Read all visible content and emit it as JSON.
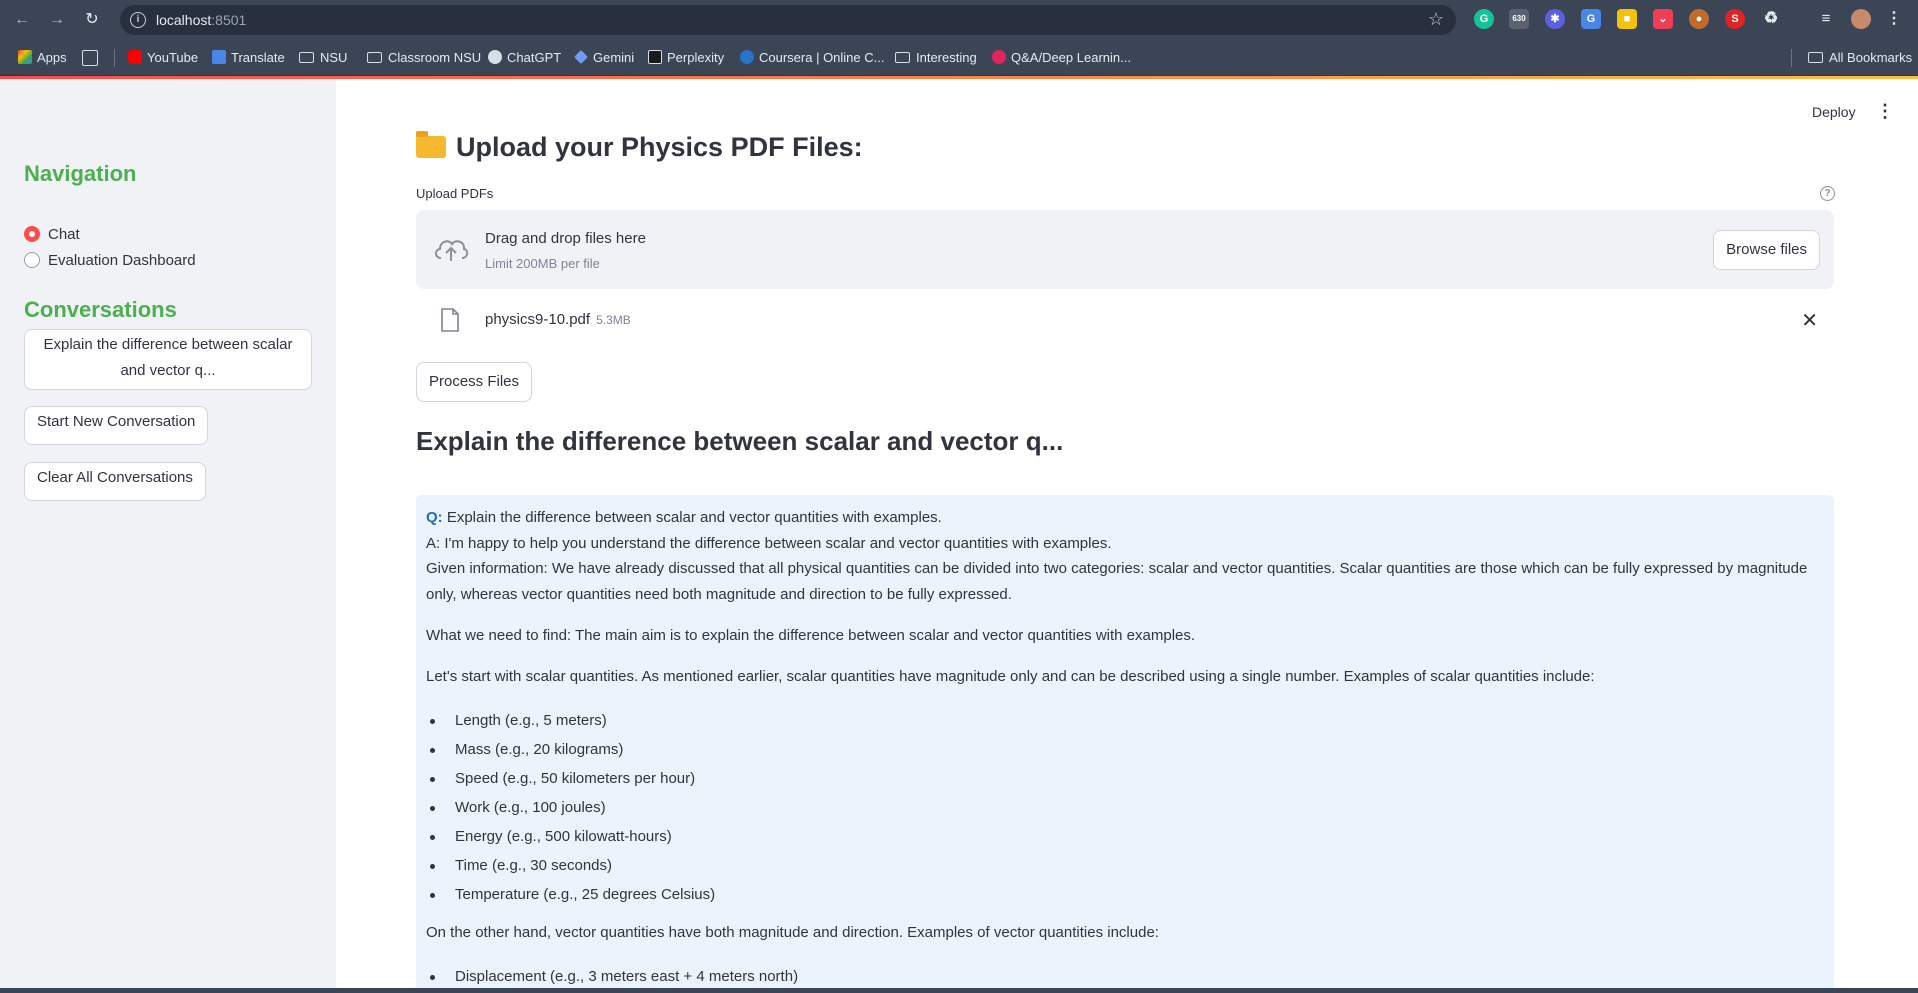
{
  "browser": {
    "url_host": "localhost",
    "url_port": ":8501",
    "ext_badge_count": "630",
    "bookmarks": [
      {
        "label": "Apps"
      },
      {
        "label": "YouTube"
      },
      {
        "label": "Translate"
      },
      {
        "label": "NSU"
      },
      {
        "label": "Classroom NSU"
      },
      {
        "label": "ChatGPT"
      },
      {
        "label": "Gemini"
      },
      {
        "label": "Perplexity"
      },
      {
        "label": "Coursera | Online C..."
      },
      {
        "label": "Interesting"
      },
      {
        "label": "Q&A/Deep Learnin..."
      }
    ],
    "all_bookmarks": "All Bookmarks"
  },
  "sidebar": {
    "nav_title": "Navigation",
    "radio_options": [
      {
        "label": "Chat",
        "selected": true
      },
      {
        "label": "Evaluation Dashboard",
        "selected": false
      }
    ],
    "conv_title": "Conversations",
    "conversation_items": [
      {
        "label": "Explain the difference between scalar and vector q..."
      }
    ],
    "new_conv_label": "Start New Conversation",
    "clear_label": "Clear All Conversations"
  },
  "header": {
    "deploy_label": "Deploy"
  },
  "upload": {
    "heading": "Upload your Physics PDF Files:",
    "label": "Upload PDFs",
    "drop_title": "Drag and drop files here",
    "drop_limit": "Limit 200MB per file",
    "browse_label": "Browse files",
    "file_name": "physics9-10.pdf",
    "file_size": "5.3MB",
    "process_label": "Process Files"
  },
  "conversation": {
    "heading": "Explain the difference between scalar and vector q...",
    "q_prefix": "Q:",
    "question": " Explain the difference between scalar and vector quantities with examples.",
    "answer_intro": "A: I'm happy to help you understand the difference between scalar and vector quantities with examples.",
    "given_info": "Given information: We have already discussed that all physical quantities can be divided into two categories: scalar and vector quantities. Scalar quantities are those which can be fully expressed by magnitude only, whereas vector quantities need both magnitude and direction to be fully expressed.",
    "need_to_find": "What we need to find: The main aim is to explain the difference between scalar and vector quantities with examples.",
    "scalar_intro": "Let's start with scalar quantities. As mentioned earlier, scalar quantities have magnitude only and can be described using a single number. Examples of scalar quantities include:",
    "scalar_examples": [
      "Length (e.g., 5 meters)",
      "Mass (e.g., 20 kilograms)",
      "Speed (e.g., 50 kilometers per hour)",
      "Work (e.g., 100 joules)",
      "Energy (e.g., 500 kilowatt-hours)",
      "Time (e.g., 30 seconds)",
      "Temperature (e.g., 25 degrees Celsius)"
    ],
    "vector_intro": "On the other hand, vector quantities have both magnitude and direction. Examples of vector quantities include:",
    "vector_examples": [
      "Displacement (e.g., 3 meters east + 4 meters north)"
    ]
  },
  "colors": {
    "accent_red": "#ff4b4b",
    "heading_green": "#4caf50",
    "answer_bg": "#ebf4fc",
    "q_blue": "#1c6dbf"
  }
}
